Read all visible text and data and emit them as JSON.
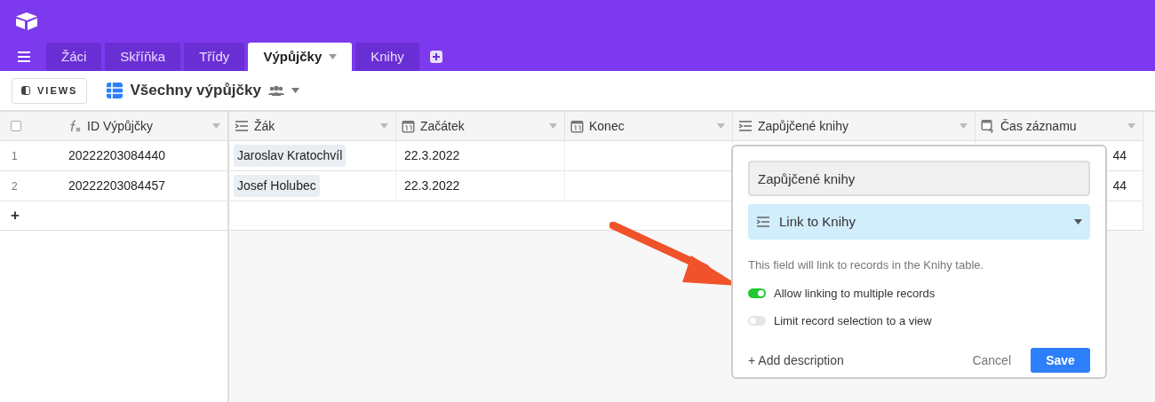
{
  "tabs": [
    {
      "label": "Žáci",
      "selected": false
    },
    {
      "label": "Skříňka",
      "selected": false
    },
    {
      "label": "Třídy",
      "selected": false
    },
    {
      "label": "Výpůjčky",
      "selected": true
    },
    {
      "label": "Knihy",
      "selected": false
    }
  ],
  "toolbar": {
    "views_button": "VIEWS",
    "view_name": "Všechny výpůjčky"
  },
  "columns": [
    {
      "label": "ID Výpůjčky",
      "kind": "formula"
    },
    {
      "label": "Žák",
      "kind": "link"
    },
    {
      "label": "Začátek",
      "kind": "date"
    },
    {
      "label": "Konec",
      "kind": "date"
    },
    {
      "label": "Zapůjčené knihy",
      "kind": "link"
    },
    {
      "label": "Čas záznamu",
      "kind": "created"
    }
  ],
  "select_all_checked": false,
  "rows": [
    {
      "number": "1",
      "id": "20222203084440",
      "student": "Jaroslav Kratochvíl",
      "start": "22.3.2022",
      "time": "44"
    },
    {
      "number": "2",
      "id": "20222203084457",
      "student": "Josef Holubec",
      "start": "22.3.2022",
      "time": "44"
    }
  ],
  "add_row": "+",
  "popup": {
    "name_value": "Zapůjčené knihy",
    "type_label": "Link to Knihy",
    "description": "This field will link to records in the Knihy table.",
    "options": [
      {
        "label": "Allow linking to multiple records",
        "on": true
      },
      {
        "label": "Limit record selection to a view",
        "on": false
      }
    ],
    "add_description": "+ Add description",
    "cancel": "Cancel",
    "save": "Save"
  }
}
